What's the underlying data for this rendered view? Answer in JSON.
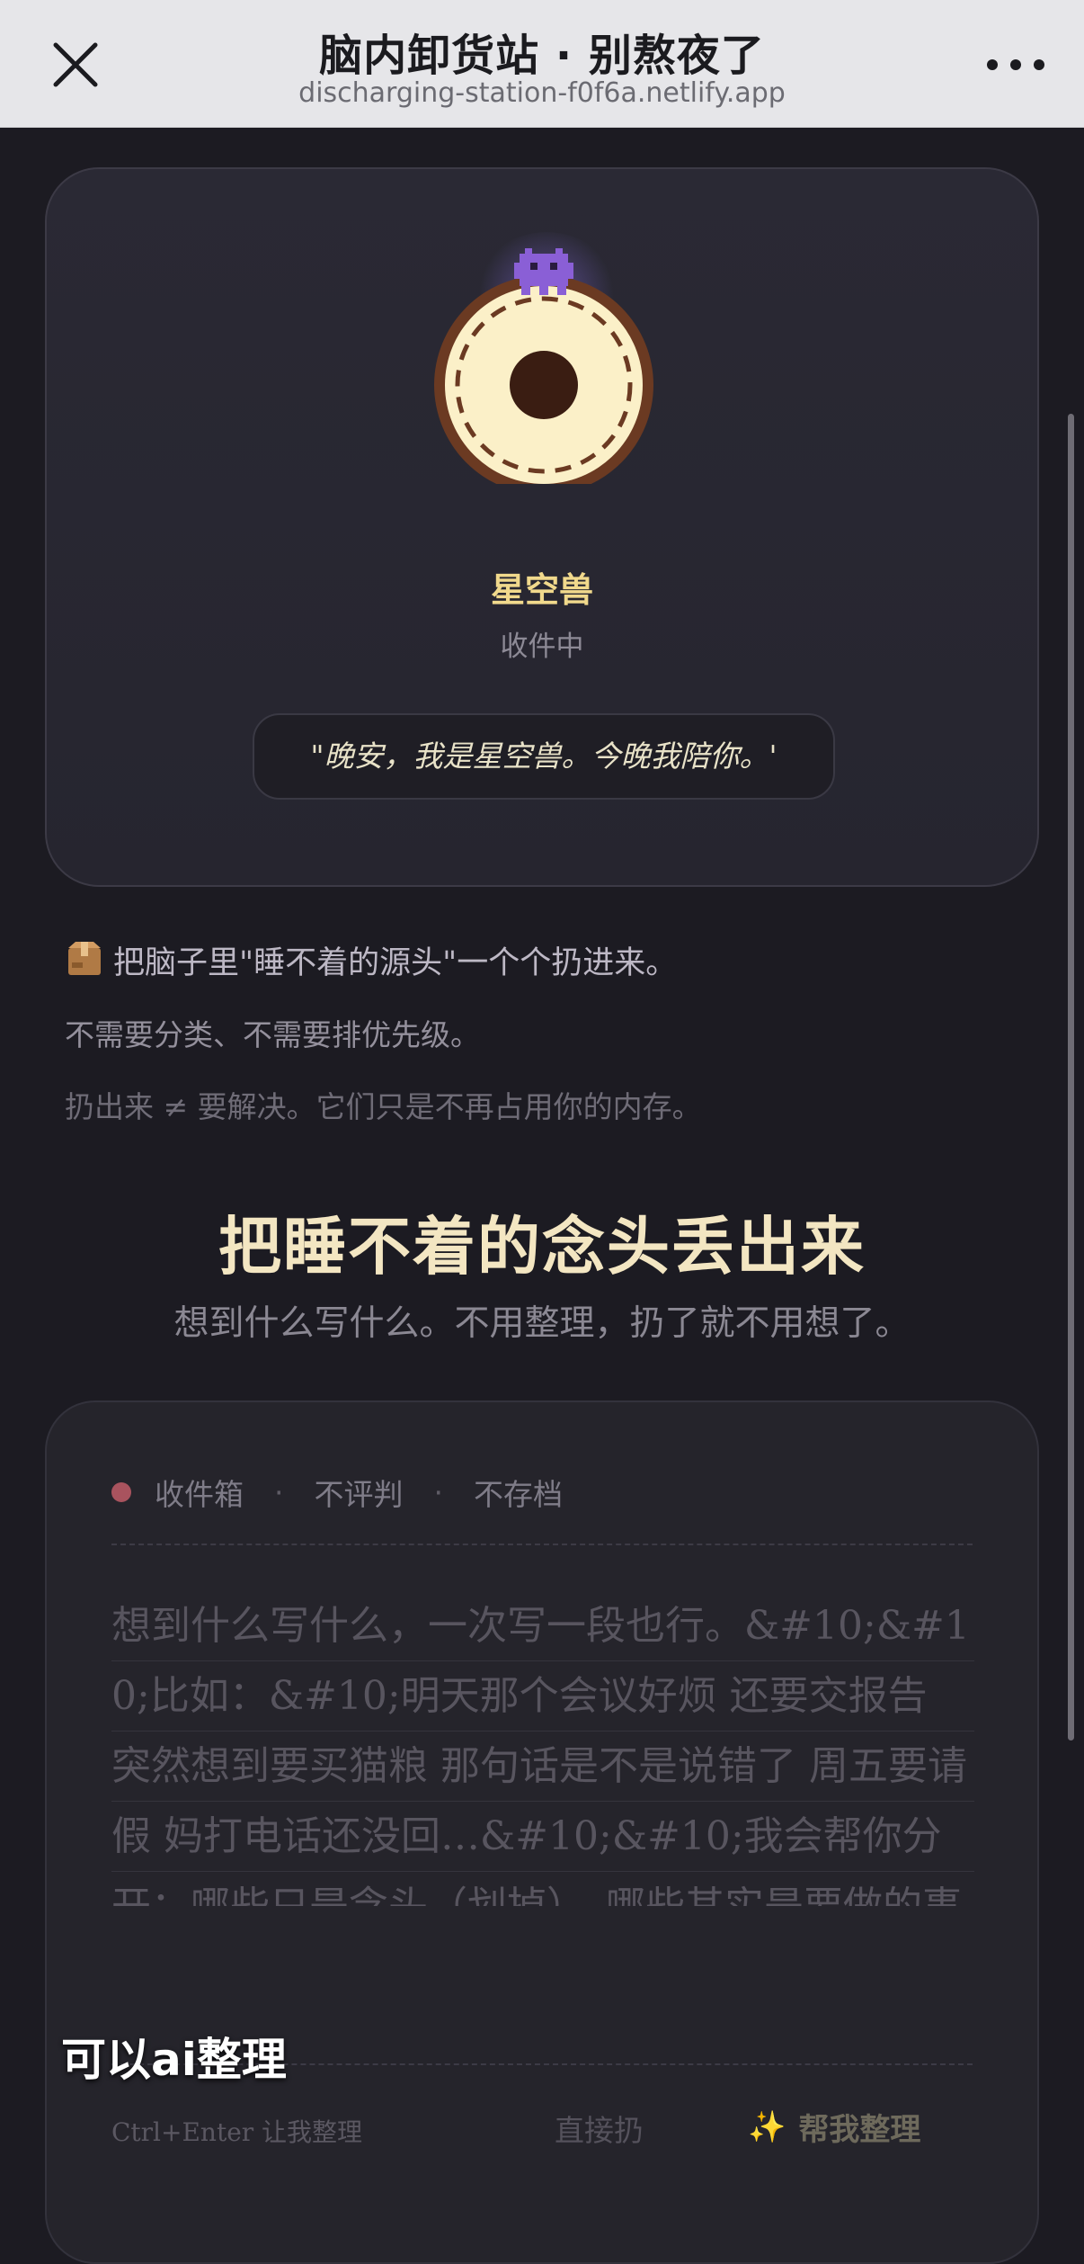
{
  "browser": {
    "title": "脑内卸货站 · 别熬夜了",
    "url": "discharging-station-f0f6a.netlify.app",
    "close_icon": "close-icon",
    "menu_icon": "more-horizontal-icon"
  },
  "mascot": {
    "name": "星空兽",
    "status": "收件中",
    "quote": "\"晚安，我是星空兽。今晚我陪你。'",
    "icon": "pixel-creature-icon"
  },
  "intro": {
    "line1": "把脑子里\"睡不着的源头\"一个个扔进来。",
    "line2": "不需要分类、不需要排优先级。",
    "line3": "扔出来 ≠ 要解决。它们只是不再占用你的内存。",
    "icon": "package-icon"
  },
  "heading": {
    "title": "把睡不着的念头丢出来",
    "subtitle": "想到什么写什么。不用整理，扔了就不用想了。"
  },
  "input_card": {
    "tag1": "收件箱",
    "tag2": "不评判",
    "tag3": "不存档",
    "separator": "·",
    "placeholder": "想到什么写什么，一次写一段也行。&#10;&#10;比如：&#10;明天那个会议好烦 还要交报告 突然想到要买猫粮 那句话是不是说错了 周五要请假 妈打电话还没回…&#10;&#10;我会帮你分开：哪些只是念头（划掉），哪些其实是要做的事（记下",
    "hint": "Ctrl+Enter 让我整理",
    "direct_button": "直接扔",
    "help_button": "帮我整理",
    "sparkle": "✨"
  },
  "overlay_caption": "可以ai整理",
  "colors": {
    "background": "#1c1b22",
    "accent_gold": "#f1d98c",
    "status_dot": "#a9535e",
    "mascot_purple": "#8a5fd6"
  }
}
